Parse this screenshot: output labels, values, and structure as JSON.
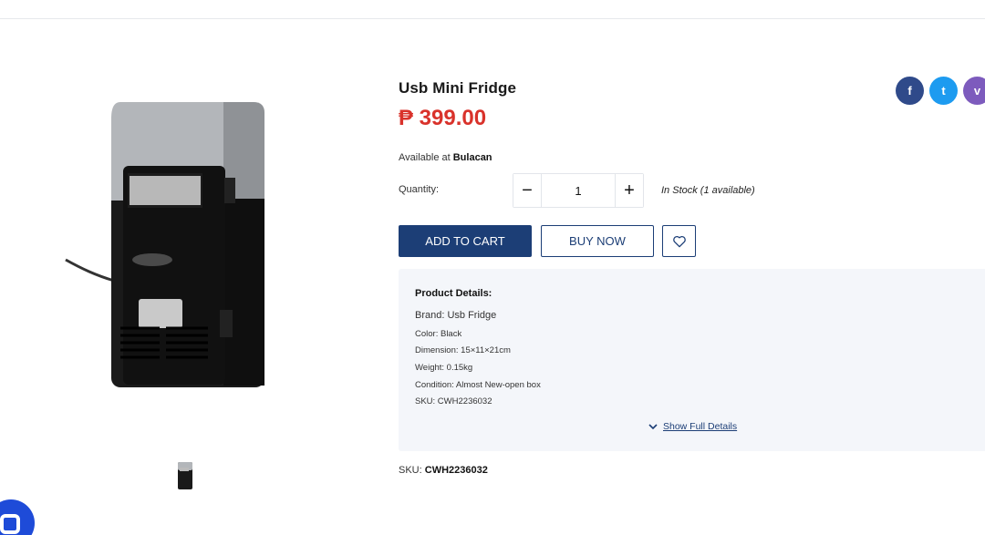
{
  "product": {
    "title": "Usb Mini Fridge",
    "price": "₱ 399.00",
    "availability_prefix": "Available at",
    "availability_location": "Bulacan",
    "quantity_label": "Quantity:",
    "quantity_value": "1",
    "decrement_label": "−",
    "increment_label": "+",
    "stock_status": "In Stock (1 available)",
    "add_to_cart_label": "ADD TO CART",
    "buy_now_label": "BUY NOW",
    "sku_prefix": "SKU:",
    "sku_value": "CWH2236032"
  },
  "share": {
    "facebook_glyph": "f",
    "twitter_glyph": "t",
    "viber_glyph": "v",
    "icons": [
      "facebook-icon",
      "twitter-icon",
      "viber-icon"
    ]
  },
  "details": {
    "header": "Product Details:",
    "brand": "Brand: Usb Fridge",
    "color": "Color: Black",
    "dimension": "Dimension: 15×11×21cm",
    "weight": "Weight: 0.15kg",
    "condition": "Condition: Almost New-open box",
    "sku": "SKU: CWH2236032",
    "show_full_label": "Show Full Details"
  },
  "colors": {
    "primary": "#1c3e76",
    "price": "#d9322b",
    "facebook": "#2f4a8a",
    "twitter": "#1d9bf0",
    "viber": "#7d5bbd",
    "details_bg": "#f4f6fa",
    "chat": "#1e4bd8"
  }
}
